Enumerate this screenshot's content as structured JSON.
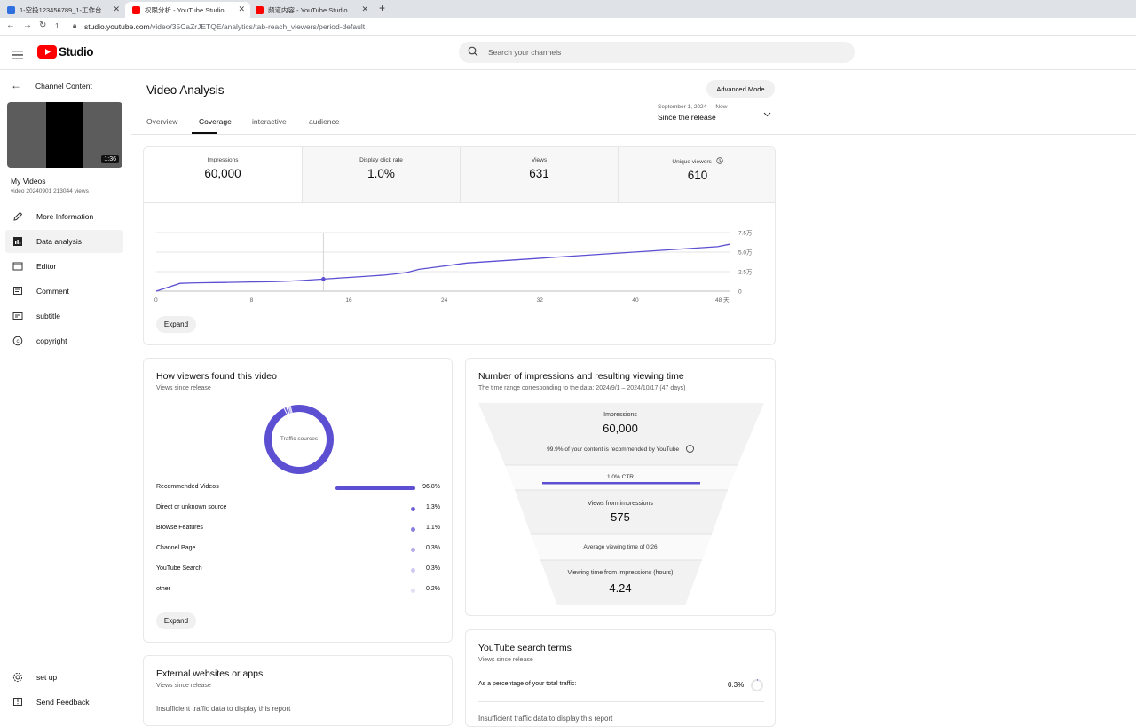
{
  "browser": {
    "tabs": [
      {
        "title": "1-空投123456789_1-工作台",
        "active": false
      },
      {
        "title": "权限分析 - YouTube Studio",
        "active": true
      },
      {
        "title": "频道内容 - YouTube Studio",
        "active": false
      }
    ],
    "reload_number": "1",
    "url_host": "studio.youtube.com",
    "url_path": "/video/35CaZrJETQE/analytics/tab-reach_viewers/period-default"
  },
  "header": {
    "logo_text": "Studio",
    "search_placeholder": "Search your channels"
  },
  "sidebar": {
    "back_label": "Channel Content",
    "video_duration": "1:36",
    "video_title": "My Videos",
    "video_subtitle": "video 20240901 213044 views",
    "items": [
      {
        "label": "More Information",
        "icon": "pencil-icon"
      },
      {
        "label": "Data analysis",
        "icon": "analytics-icon"
      },
      {
        "label": "Editor",
        "icon": "clapperboard-icon"
      },
      {
        "label": "Comment",
        "icon": "comment-icon"
      },
      {
        "label": "subtitle",
        "icon": "subtitle-icon"
      },
      {
        "label": "copyright",
        "icon": "copyright-icon"
      }
    ],
    "bottom_items": [
      {
        "label": "set up",
        "icon": "gear-icon"
      },
      {
        "label": "Send Feedback",
        "icon": "feedback-icon"
      }
    ]
  },
  "page": {
    "title": "Video Analysis",
    "advanced_mode": "Advanced Mode",
    "tabs": [
      "Overview",
      "Coverage",
      "interactive",
      "audience"
    ],
    "active_tab": "Coverage",
    "date_range": "September 1, 2024 — Now",
    "period": "Since the release"
  },
  "metrics": [
    {
      "label": "Impressions",
      "value": "60,000"
    },
    {
      "label": "Display click rate",
      "value": "1.0%"
    },
    {
      "label": "Views",
      "value": "631"
    },
    {
      "label": "Unique viewers",
      "value": "610"
    }
  ],
  "chart_data": {
    "type": "line",
    "x": [
      0,
      1,
      2,
      3,
      4,
      5,
      6,
      7,
      8,
      9,
      10,
      11,
      12,
      13,
      14,
      15,
      16,
      17,
      18,
      19,
      20,
      21,
      22,
      23,
      24,
      25,
      26,
      27,
      28,
      29,
      30,
      31,
      32,
      33,
      34,
      35,
      36,
      37,
      38,
      39,
      40,
      41,
      42,
      43,
      44,
      45,
      46,
      47,
      48
    ],
    "y": [
      0,
      5000,
      10000,
      10500,
      10800,
      11000,
      11200,
      11500,
      11800,
      12000,
      12300,
      12800,
      13500,
      14500,
      15500,
      16500,
      17500,
      18500,
      19500,
      20500,
      22000,
      24000,
      28000,
      30000,
      32000,
      34000,
      36000,
      37000,
      38000,
      39000,
      40000,
      41000,
      42000,
      43000,
      44000,
      45000,
      46000,
      47000,
      48000,
      49000,
      50000,
      51000,
      52000,
      53000,
      54000,
      55000,
      56000,
      57000,
      60000
    ],
    "xticks": [
      "0",
      "8",
      "16",
      "24",
      "32",
      "40",
      "48 天"
    ],
    "yticks": [
      "0",
      "2.5万",
      "5.0万",
      "7.5万"
    ],
    "ylim": [
      0,
      75000
    ],
    "xlim": [
      0,
      48
    ],
    "hover_x": 14,
    "color": "#5c4fd2",
    "grid": true
  },
  "chart_expand": "Expand",
  "traffic": {
    "title": "How viewers found this video",
    "subtitle": "Views since release",
    "donut_label": "Traffic sources",
    "sources": [
      {
        "name": "Recommended Videos",
        "pct": "96.8%",
        "value": 96.8
      },
      {
        "name": "Direct or unknown source",
        "pct": "1.3%",
        "value": 1.3
      },
      {
        "name": "Browse Features",
        "pct": "1.1%",
        "value": 1.1
      },
      {
        "name": "Channel Page",
        "pct": "0.3%",
        "value": 0.3
      },
      {
        "name": "YouTube Search",
        "pct": "0.3%",
        "value": 0.3
      },
      {
        "name": "other",
        "pct": "0.2%",
        "value": 0.2
      }
    ],
    "expand": "Expand"
  },
  "funnel": {
    "title": "Number of impressions and resulting viewing time",
    "subtitle": "The time range corresponding to the data: 2024/9/1 – 2024/10/17 (47 days)",
    "impressions_label": "Impressions",
    "impressions_value": "60,000",
    "recommended_note": "99.9% of your content is recommended by YouTube",
    "ctr": "1.0% CTR",
    "views_label": "Views from impressions",
    "views_value": "575",
    "avg_view": "Average viewing time of 0:26",
    "watch_label": "Viewing time from impressions (hours)",
    "watch_value": "4.24"
  },
  "external": {
    "title": "External websites or apps",
    "subtitle": "Views since release",
    "empty": "Insufficient traffic data to display this report"
  },
  "search_terms": {
    "title": "YouTube search terms",
    "subtitle": "Views since release",
    "row_label": "As a percentage of your total traffic:",
    "row_value": "0.3%",
    "empty": "Insufficient traffic data to display this report"
  },
  "colors": {
    "accent": "#5c4fd2",
    "youtube_red": "#ff0000"
  }
}
